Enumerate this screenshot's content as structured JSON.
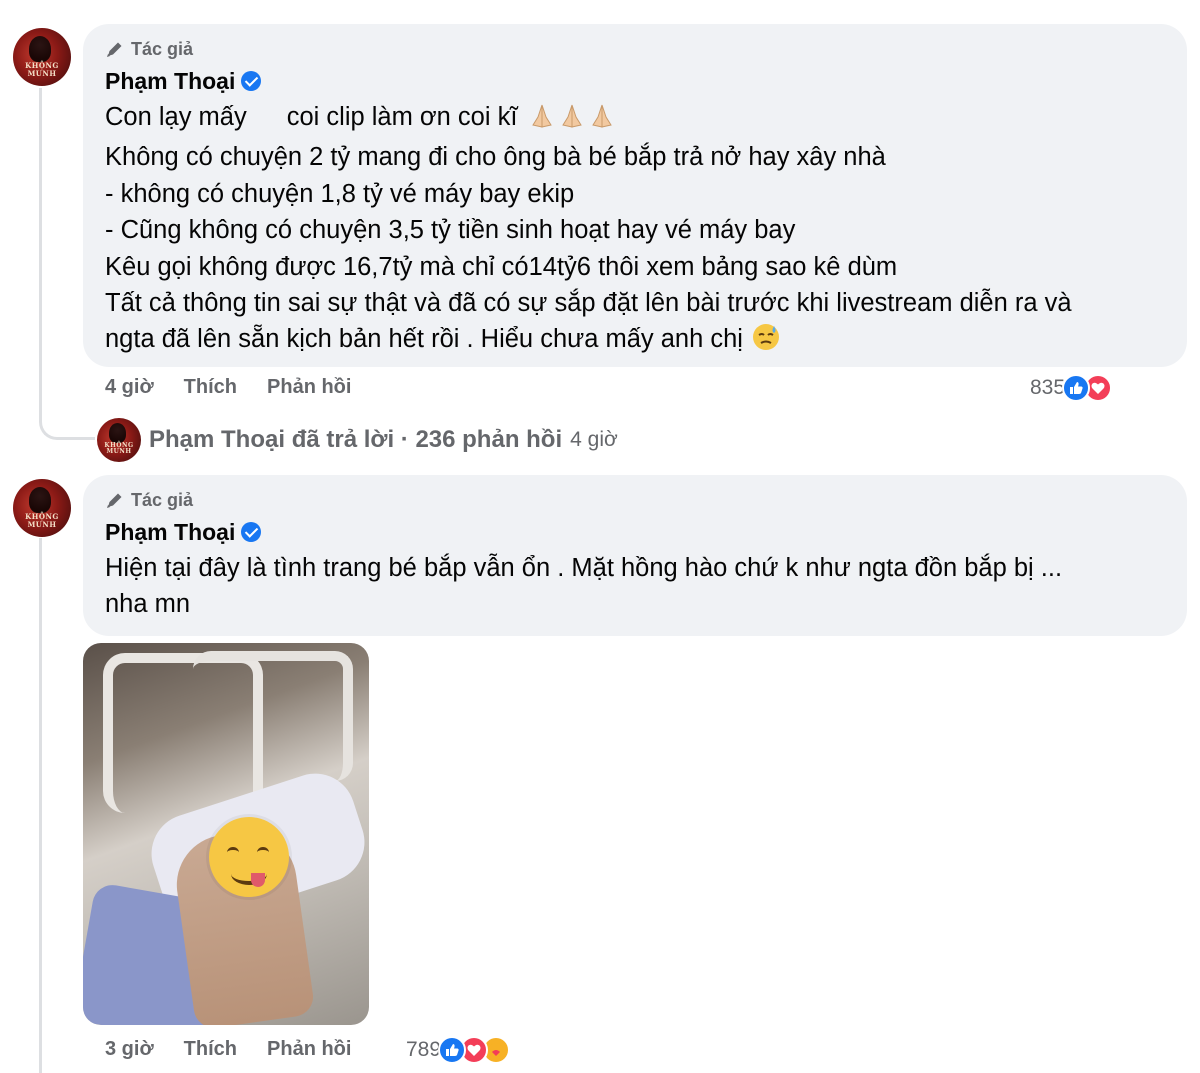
{
  "comments": [
    {
      "badge": "Tác giả",
      "author": "Phạm Thoại",
      "lines": [
        "Con lạy mấy",
        "coi clip làm ơn coi kĩ",
        "Không có chuyện 2 tỷ mang đi cho ông bà bé bắp trả nở hay xây nhà",
        "- không có chuyện 1,8 tỷ vé máy bay ekip",
        "- Cũng không có chuyện 3,5 tỷ tiền sinh hoạt hay vé máy bay",
        "Kêu gọi không được 16,7tỷ mà chỉ có14tỷ6 thôi xem bảng sao kê dùm",
        "Tất cả thông tin sai sự thật và đã có sự sắp đặt lên bài trước khi livestream diễn ra và",
        "ngta đã lên sẵn kịch bản hết rồi . Hiểu chưa mấy anh chị"
      ],
      "time": "4 giờ",
      "like_label": "Thích",
      "reply_label": "Phản hồi",
      "reaction_count": "835",
      "reactions": [
        "like-icon",
        "love-icon"
      ]
    },
    {
      "badge": "Tác giả",
      "author": "Phạm Thoại",
      "lines": [
        "Hiện tại đây là tình trang bé bắp vẫn ổn . Mặt hồng hào chứ k như ngta đồn bắp bị ...",
        "nha mn"
      ],
      "time": "3 giờ",
      "like_label": "Thích",
      "reply_label": "Phản hồi",
      "reaction_count": "789",
      "reactions": [
        "like-icon",
        "love-icon",
        "care-icon"
      ]
    }
  ],
  "reply_summary": {
    "text": "Phạm Thoại đã trả lời · 236 phản hồi",
    "time": "4 giờ"
  },
  "avatar_text": "KHỘNG MUNH",
  "colors": {
    "bubble_bg": "#f0f2f5",
    "meta_text": "#65676b",
    "like_blue": "#1877f2",
    "love_red": "#f33e58"
  }
}
